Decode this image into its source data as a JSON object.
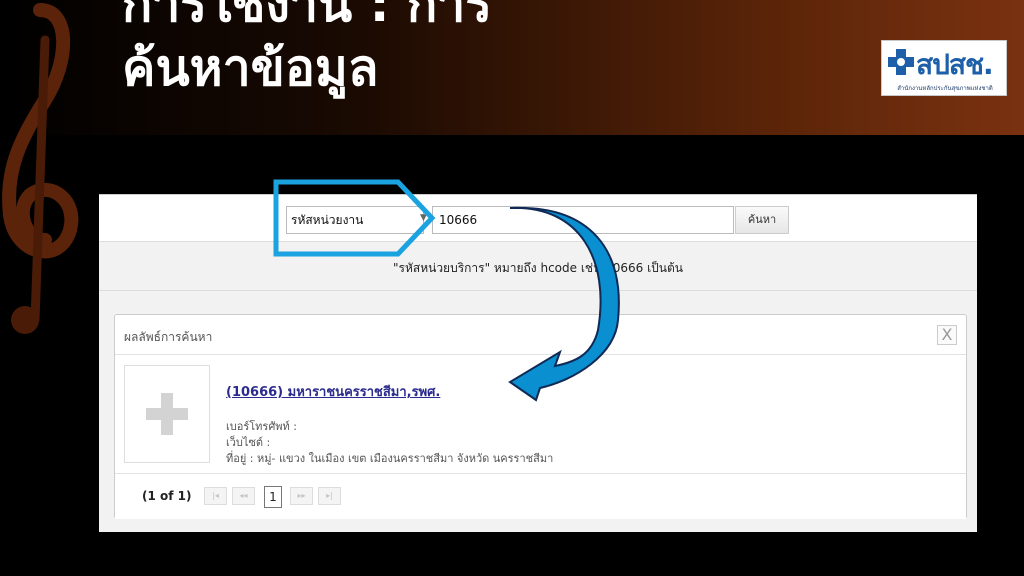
{
  "slide": {
    "title_line1": "การใช้งาน : การ",
    "title_line2": "ค้นหาข้อมูล"
  },
  "logo": {
    "name": "สปสช.",
    "subtitle": "สำนักงานหลักประกันสุขภาพแห่งชาติ",
    "icon": "nhso-cross-icon"
  },
  "search": {
    "type_selected": "รหัสหน่วยงาน",
    "input_value": "10666",
    "button_label": "ค้นหา",
    "hint": "\"รหัสหน่วยบริการ\" หมายถึง hcode เช่น 10666 เป็นต้น"
  },
  "results": {
    "header": "ผลลัพธ์การค้นหา",
    "close_label": "X",
    "items": [
      {
        "name": "(10666) มหาราชนครราชสีมา,รพศ.",
        "phone": "เบอร์โทรศัพท์ :",
        "website": "เว็บไซต์ :",
        "address": "ที่อยู่ : หมู่- แขวง ในเมือง เขต เมืองนครราชสีมา จังหวัด นครราชสีมา"
      }
    ]
  },
  "paginator": {
    "report": "(1 of 1)",
    "current_page": "1",
    "first": "|◂",
    "prev": "◂◂",
    "next": "▸▸",
    "last": "▸|"
  },
  "colors": {
    "highlight": "#1aa3e0",
    "arrow": "#0a8fd0",
    "link": "#2b2b8f",
    "title_band_end": "#7a3210"
  }
}
